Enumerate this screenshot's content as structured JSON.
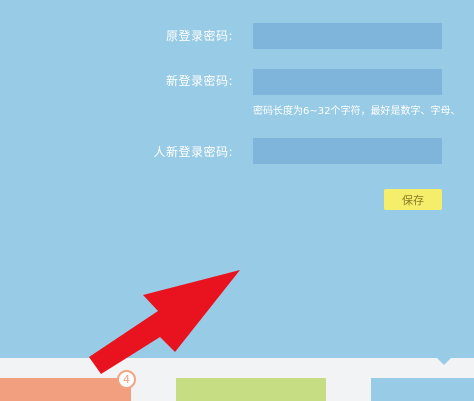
{
  "form": {
    "old_password_label": "原登录密码:",
    "new_password_label": "新登录密码:",
    "confirm_password_label": "人新登录密码:",
    "old_password_value": "",
    "new_password_value": "",
    "confirm_password_value": "",
    "hint": "密码长度为6~32个字符，最好是数字、字母、",
    "save_label": "保存"
  },
  "bottom_nav": {
    "badge_count": "4"
  },
  "colors": {
    "panel": "#98cbe5",
    "field": "#7fb4db",
    "save_button": "#f5ee6a",
    "arrow": "#e8131f"
  }
}
